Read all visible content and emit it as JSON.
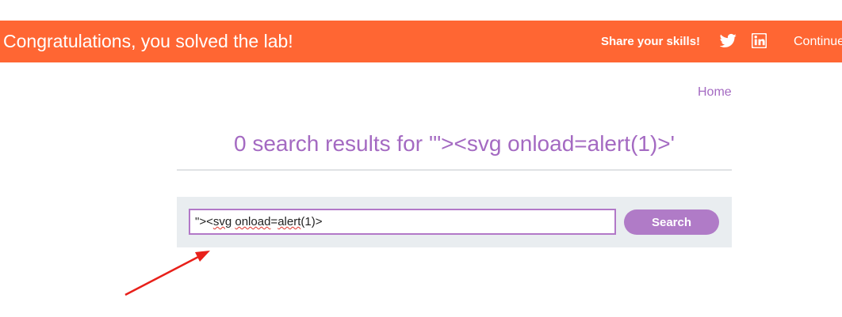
{
  "banner": {
    "title": "Congratulations, you solved the lab!",
    "share_label": "Share your skills!",
    "share_icons": [
      "twitter-icon",
      "linkedin-icon"
    ],
    "continue_label": "Continue",
    "background_color": "#ff6633"
  },
  "nav": {
    "home_label": "Home"
  },
  "results": {
    "heading": "0 search results for '\"><svg onload=alert(1)>'"
  },
  "search": {
    "value_prefix": "\"><",
    "value_word1": "svg",
    "value_space": " ",
    "value_word2": "onload",
    "value_eq": "=",
    "value_word3": "alert",
    "value_suffix": "(1)>",
    "button_label": "Search"
  },
  "annotation": {
    "arrow_color": "#e8201a",
    "arrow_icon": "arrow-icon"
  },
  "colors": {
    "accent": "#a46ac2",
    "button": "#b07bc7",
    "panel": "#e9edf0"
  }
}
